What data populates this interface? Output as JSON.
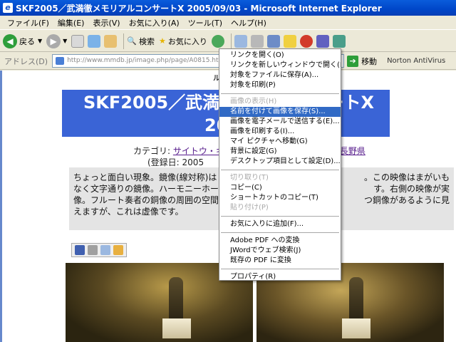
{
  "window": {
    "title": "SKF2005／武満徹メモリアルコンサートX 2005/09/03 - Microsoft Internet Explorer"
  },
  "menubar": {
    "items": [
      "ファイル(F)",
      "編集(E)",
      "表示(V)",
      "お気に入り(A)",
      "ツール(T)",
      "ヘルプ(H)"
    ]
  },
  "toolbar": {
    "back_label": "戻る",
    "search_label": "検索",
    "favorites_label": "お気に入り"
  },
  "addressbar": {
    "label": "アドレス(D)",
    "url": "http://www.mmdb.jp/image.php/page/A0815.html",
    "go_label": "移動",
    "norton_label": "Norton AntiVirus"
  },
  "page": {
    "top_caption": "ル",
    "heading_line1": "SKF2005／武満",
    "heading_line1_end": "ンサートX",
    "heading_line2": "20",
    "category_prefix": "カテゴリ: ",
    "category_link1": "サイトウ・キネ",
    "category_link2": "長野県",
    "regdate": "(登録日: 2005",
    "body_text": "ちょっと面白い現象。鏡像(線対称)は",
    "body_text_2": "なく文字通りの鏡像。ハーモニーホール",
    "body_text_3": "像。フルート奏者の銅像の周囲の空間",
    "body_text_4": "えますが、これは虚像です。",
    "body_right_1": "。この映像はまがいも",
    "body_right_2": "す。右側の映像が実",
    "body_right_3": "つ銅像があるように見"
  },
  "context_menu": {
    "items": [
      {
        "label": "リンクを開く(O)",
        "state": "normal"
      },
      {
        "label": "リンクを新しいウィンドウで開く(N)",
        "state": "normal"
      },
      {
        "label": "対象をファイルに保存(A)...",
        "state": "normal"
      },
      {
        "label": "対象を印刷(P)",
        "state": "normal"
      },
      {
        "sep": true
      },
      {
        "label": "画像の表示(H)",
        "state": "disabled"
      },
      {
        "label": "名前を付けて画像を保存(S)...",
        "state": "selected"
      },
      {
        "label": "画像を電子メールで送信する(E)...",
        "state": "normal"
      },
      {
        "label": "画像を印刷する(I)...",
        "state": "normal"
      },
      {
        "label": "マイ ピクチャへ移動(G)",
        "state": "normal"
      },
      {
        "label": "背景に設定(G)",
        "state": "normal"
      },
      {
        "label": "デスクトップ項目として設定(D)...",
        "state": "normal"
      },
      {
        "sep": true
      },
      {
        "label": "切り取り(T)",
        "state": "disabled"
      },
      {
        "label": "コピー(C)",
        "state": "normal"
      },
      {
        "label": "ショートカットのコピー(T)",
        "state": "normal"
      },
      {
        "label": "貼り付け(P)",
        "state": "disabled"
      },
      {
        "sep": true
      },
      {
        "label": "お気に入りに追加(F)...",
        "state": "normal"
      },
      {
        "sep": true
      },
      {
        "label": "Adobe PDF への変換",
        "state": "normal"
      },
      {
        "label": "JWordでウェブ検索(J)",
        "state": "normal"
      },
      {
        "label": "既存の PDF に変換",
        "state": "normal"
      },
      {
        "sep": true
      },
      {
        "label": "プロパティ(R)",
        "state": "normal"
      }
    ]
  },
  "colors": {
    "titlebar": "#0a5cdb",
    "heading_bg": "#3a64d6",
    "menu_selected": "#316ac5"
  }
}
